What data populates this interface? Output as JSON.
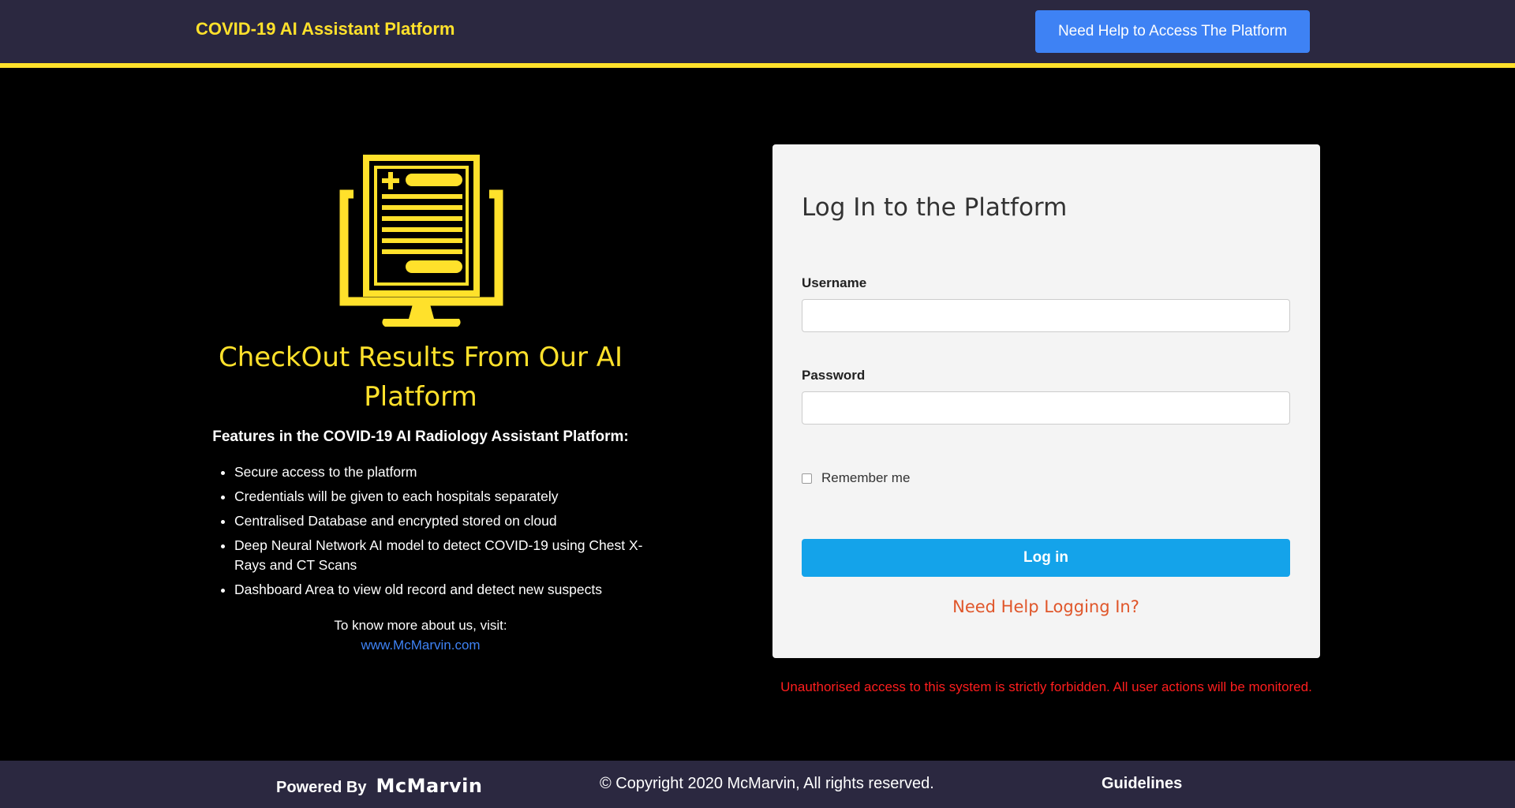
{
  "header": {
    "title": "COVID-19 AI Assistant Platform",
    "help_button": "Need Help to Access The Platform"
  },
  "hero": {
    "icon": "medical-report-monitor-icon",
    "heading": "CheckOut Results From Our AI Platform",
    "features_title": "Features in the COVID-19 AI Radiology Assistant Platform:",
    "features": [
      "Secure access to the platform",
      "Credentials will be given to each hospitals separately",
      "Centralised Database and encrypted stored on cloud",
      "Deep Neural Network AI model to detect COVID-19 using Chest X-Rays and CT Scans",
      "Dashboard Area to view old record and detect new suspects"
    ],
    "visit_text": "To know more about us, visit:",
    "visit_link": "www.McMarvin.com"
  },
  "login": {
    "title": "Log In to the Platform",
    "username_label": "Username",
    "username_value": "",
    "password_label": "Password",
    "password_value": "",
    "remember_label": "Remember me",
    "remember_checked": false,
    "submit_label": "Log in",
    "help_link": "Need Help Logging In?"
  },
  "warning": "Unauthorised access to this system is strictly forbidden. All user actions will be monitored.",
  "footer": {
    "powered_by": "Powered By",
    "powered_logo": "McMarvin",
    "copyright": "© Copyright 2020 McMarvin, All rights reserved.",
    "guidelines": "Guidelines"
  },
  "colors": {
    "header_bg": "#2b2840",
    "accent_yellow": "#ffe12b",
    "help_button_blue": "#3e82f4",
    "login_button_blue": "#14a3ea",
    "help_link_orange": "#e0562a",
    "warning_red": "#ff1e1e"
  }
}
